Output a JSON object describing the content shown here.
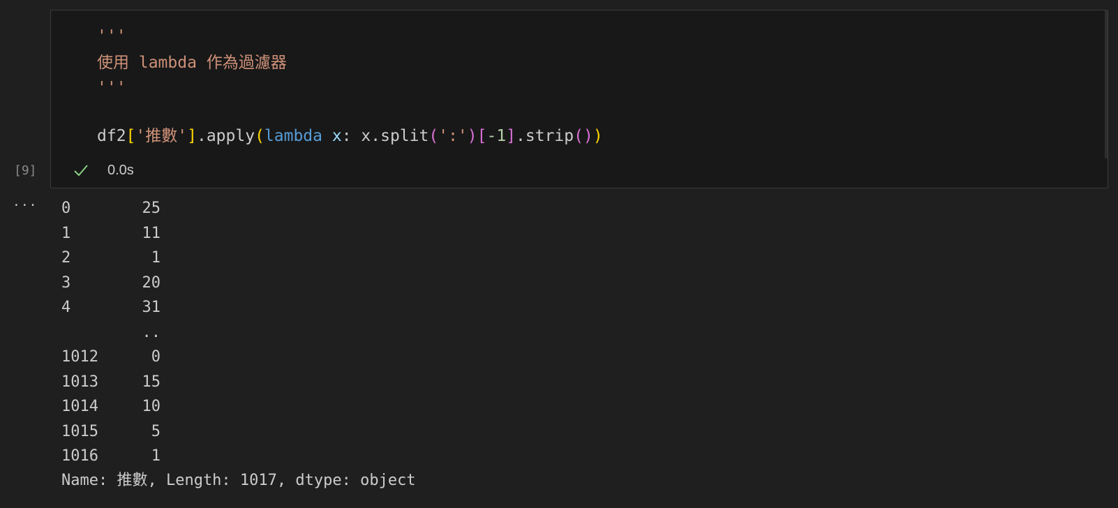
{
  "cell": {
    "execution_count": "[9]",
    "status_text": "0.0s",
    "code": {
      "docstring_open": "'''",
      "docstring_text": "使用 lambda 作為過濾器",
      "docstring_close": "'''",
      "line": {
        "df2": "df2",
        "lbracket1": "[",
        "key": "'推數'",
        "rbracket1": "]",
        "apply": ".apply",
        "lparen1": "(",
        "lambda": "lambda",
        "space": " ",
        "param": "x",
        "colon": ": x.split",
        "lparen2": "(",
        "sep": "':'",
        "rparen2": ")",
        "lbracket2": "[",
        "neg": "-1",
        "rbracket2": "]",
        "strip": ".strip",
        "lparen3": "(",
        "rparen3": ")",
        "rparen1": ")"
      }
    }
  },
  "output": {
    "ellipsis": "···",
    "rows": [
      {
        "index": "0",
        "value": "25"
      },
      {
        "index": "1",
        "value": "11"
      },
      {
        "index": "2",
        "value": "1"
      },
      {
        "index": "3",
        "value": "20"
      },
      {
        "index": "4",
        "value": "31"
      },
      {
        "index": "",
        "value": ".."
      },
      {
        "index": "1012",
        "value": "0"
      },
      {
        "index": "1013",
        "value": "15"
      },
      {
        "index": "1014",
        "value": "10"
      },
      {
        "index": "1015",
        "value": "5"
      },
      {
        "index": "1016",
        "value": "1"
      }
    ],
    "footer": "Name: 推數, Length: 1017, dtype: object"
  },
  "colors": {
    "background": "#1f1f1f",
    "editor_background": "#181818",
    "string": "#ce9178",
    "keyword": "#569cd6",
    "success_check": "#89d185"
  },
  "icons": {
    "status": "check-icon"
  }
}
